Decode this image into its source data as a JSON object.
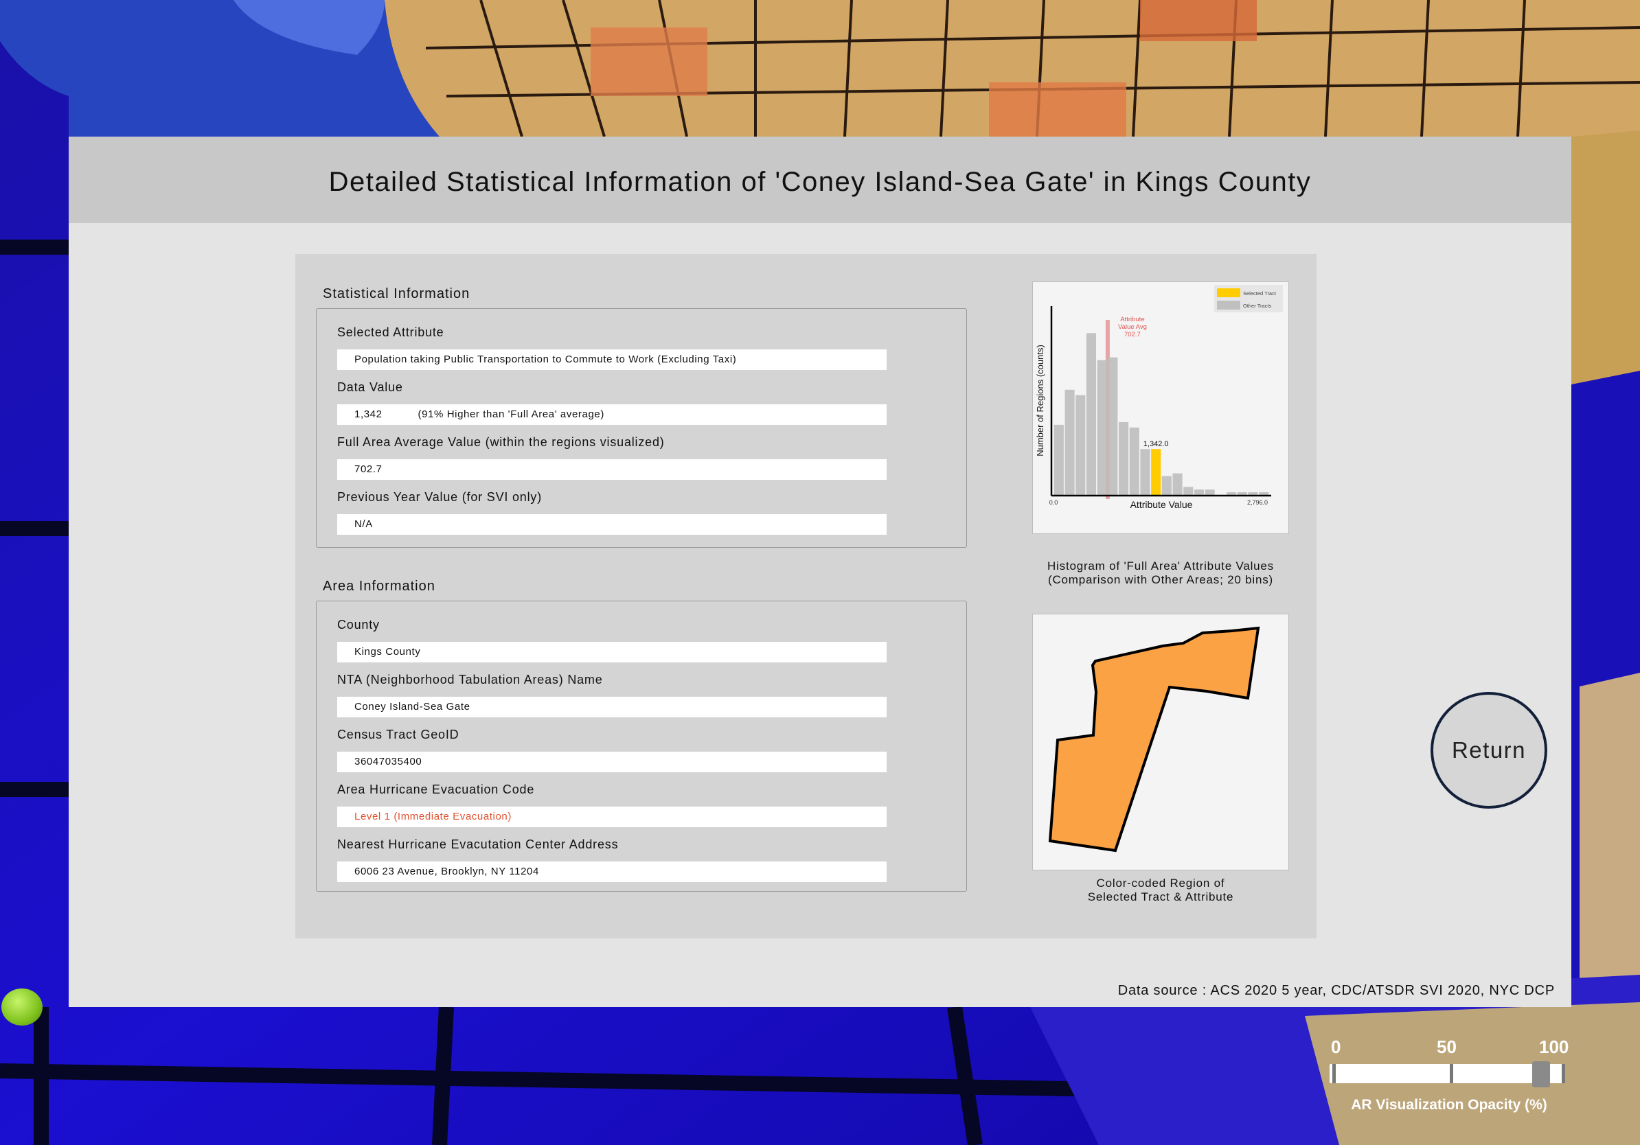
{
  "panel": {
    "title": "Detailed Statistical Information of 'Coney Island-Sea Gate' in Kings County",
    "data_source": "Data source : ACS 2020 5 year, CDC/ATSDR SVI 2020, NYC DCP"
  },
  "statistical_info": {
    "section_title": "Statistical Information",
    "selected_attribute_label": "Selected Attribute",
    "selected_attribute_value": "Population taking Public Transportation to Commute to Work (Excluding Taxi)",
    "data_value_label": "Data Value",
    "data_value": "1,342",
    "data_value_comparison": "(91% Higher than 'Full Area' average)",
    "full_area_avg_label": "Full Area Average Value (within the regions visualized)",
    "full_area_avg_value": "702.7",
    "prev_year_label": "Previous Year Value (for SVI only)",
    "prev_year_value": "N/A"
  },
  "area_info": {
    "section_title": "Area Information",
    "county_label": "County",
    "county_value": "Kings County",
    "nta_label": "NTA (Neighborhood Tabulation Areas) Name",
    "nta_value": "Coney Island-Sea Gate",
    "geoid_label": "Census Tract GeoID",
    "geoid_value": "36047035400",
    "evac_code_label": "Area Hurricane Evacuation Code",
    "evac_code_value": "Level 1 (Immediate Evacuation)",
    "evac_center_label": "Nearest Hurricane Evacutation Center Address",
    "evac_center_value": "6006 23 Avenue, Brooklyn, NY 11204"
  },
  "histogram": {
    "caption_line1": "Histogram of 'Full Area' Attribute Values",
    "caption_line2": "(Comparison with Other Areas; 20 bins)"
  },
  "region_map": {
    "caption_line1": "Color-coded Region of",
    "caption_line2": "Selected Tract & Attribute",
    "fill_color": "#fba244"
  },
  "chart_data": {
    "type": "bar",
    "title": "",
    "xlabel": "Attribute Value",
    "ylabel": "Number of Regions (counts)",
    "xlim": [
      0.0,
      2796.0
    ],
    "x_tick_labels": [
      "0.0",
      "2,796.0"
    ],
    "bins": 20,
    "values": [
      26,
      39,
      37,
      60,
      50,
      51,
      27,
      25,
      17,
      17,
      7,
      8,
      3,
      2,
      2,
      0,
      1,
      1,
      1,
      1
    ],
    "selected_bin_index": 9,
    "selected_value": 1342.0,
    "selected_value_label": "1,342.0",
    "average_value": 702.7,
    "average_label_line1": "Attribute",
    "average_label_line2": "Value Avg",
    "average_label_line3": "702.7",
    "legend": {
      "position": "top-right",
      "entries": [
        {
          "label": "Selected Tract",
          "color": "#ffcc00"
        },
        {
          "label": "Other Tracts",
          "color": "#c0c0c0"
        }
      ]
    },
    "colors": {
      "other": "#c0c0c0",
      "selected": "#ffcc00",
      "average_line": "#e48a8a"
    }
  },
  "return_button": {
    "label": "Return"
  },
  "opacity_slider": {
    "caption": "AR Visualization Opacity (%)",
    "tick_labels": [
      "0",
      "50",
      "100"
    ],
    "value_percent": 91
  }
}
